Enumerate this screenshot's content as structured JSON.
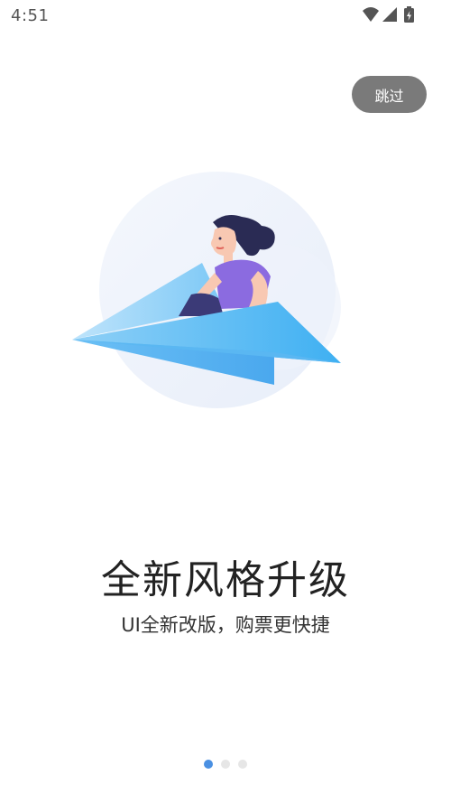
{
  "status_bar": {
    "time": "4:51",
    "icons": [
      "wifi-icon",
      "cellular-signal-icon",
      "battery-charging-icon"
    ]
  },
  "skip_button": {
    "label": "跳过"
  },
  "onboarding": {
    "headline": "全新风格升级",
    "subline": "UI全新改版，购票更快捷",
    "illustration_icon": "paper-plane-woman-illustration"
  },
  "pager": {
    "total": 3,
    "active_index": 0
  },
  "colors": {
    "skip_bg": "#7a7a7a",
    "dot_active": "#4a90e2",
    "dot_inactive": "#e6e6e6",
    "plane_blue": "#4ab8f5",
    "shirt_purple": "#8b6be0"
  }
}
